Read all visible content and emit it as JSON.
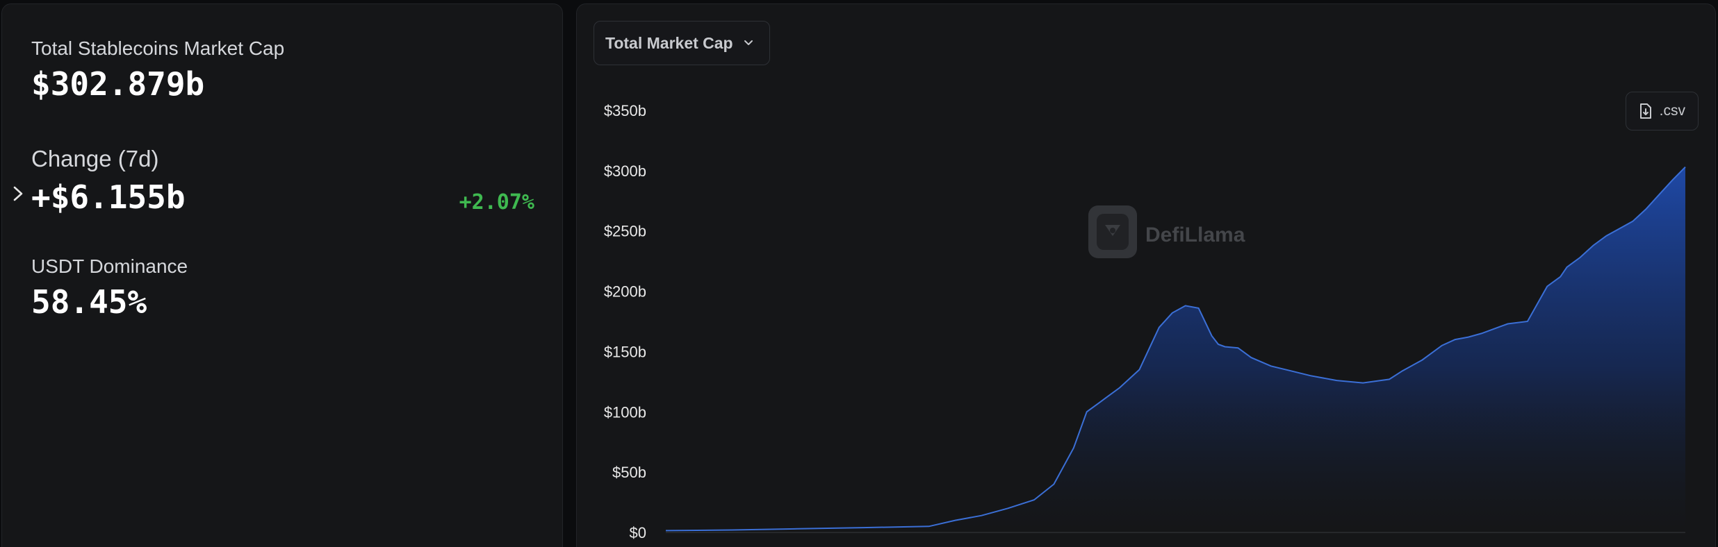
{
  "stats": {
    "total_label": "Total Stablecoins Market Cap",
    "total_value": "$302.879b",
    "change_label": "Change (7d)",
    "change_value": "+$6.155b",
    "change_pct": "+2.07%",
    "dominance_label": "USDT Dominance",
    "dominance_value": "58.45%"
  },
  "controls": {
    "metric_select": "Total Market Cap",
    "csv_label": ".csv"
  },
  "watermark": "DefiLlama",
  "colors": {
    "positive": "#3fb950",
    "line": "#3b6fd6",
    "area_top": "#1e4aa8",
    "background": "#151618"
  },
  "chart_data": {
    "type": "area",
    "ylim": [
      0,
      350
    ],
    "y_ticks": [
      {
        "value": 0,
        "label": "$0"
      },
      {
        "value": 50,
        "label": "$50b"
      },
      {
        "value": 100,
        "label": "$100b"
      },
      {
        "value": 150,
        "label": "$150b"
      },
      {
        "value": 200,
        "label": "$200b"
      },
      {
        "value": 250,
        "label": "$250b"
      },
      {
        "value": 300,
        "label": "$300b"
      },
      {
        "value": 350,
        "label": "$350b"
      }
    ],
    "xlim": [
      2018.0,
      2025.75
    ],
    "series": [
      {
        "x": [
          2018.0,
          2018.5,
          2019.0,
          2019.5,
          2020.0,
          2020.2,
          2020.4,
          2020.6,
          2020.8,
          2020.95,
          2021.1,
          2021.2,
          2021.3,
          2021.35,
          2021.45,
          2021.6,
          2021.75,
          2021.85,
          2021.95,
          2022.05,
          2022.15,
          2022.2,
          2022.25,
          2022.35,
          2022.45,
          2022.6,
          2022.75,
          2022.9,
          2023.1,
          2023.3,
          2023.5,
          2023.6,
          2023.75,
          2023.9,
          2024.0,
          2024.1,
          2024.2,
          2024.4,
          2024.55,
          2024.7,
          2024.8,
          2024.85,
          2024.95,
          2025.05,
          2025.15,
          2025.25,
          2025.35,
          2025.45,
          2025.55,
          2025.65,
          2025.75
        ],
        "y": [
          1.5,
          2,
          3,
          4,
          5,
          10,
          14,
          20,
          27,
          40,
          70,
          100,
          108,
          112,
          120,
          135,
          170,
          182,
          188,
          186,
          163,
          156,
          154,
          153,
          145,
          138,
          134,
          130,
          126,
          124,
          127,
          134,
          143,
          155,
          160,
          162,
          165,
          173,
          175,
          204,
          212,
          220,
          228,
          238,
          246,
          252,
          258,
          268,
          280,
          292,
          303
        ]
      }
    ]
  }
}
